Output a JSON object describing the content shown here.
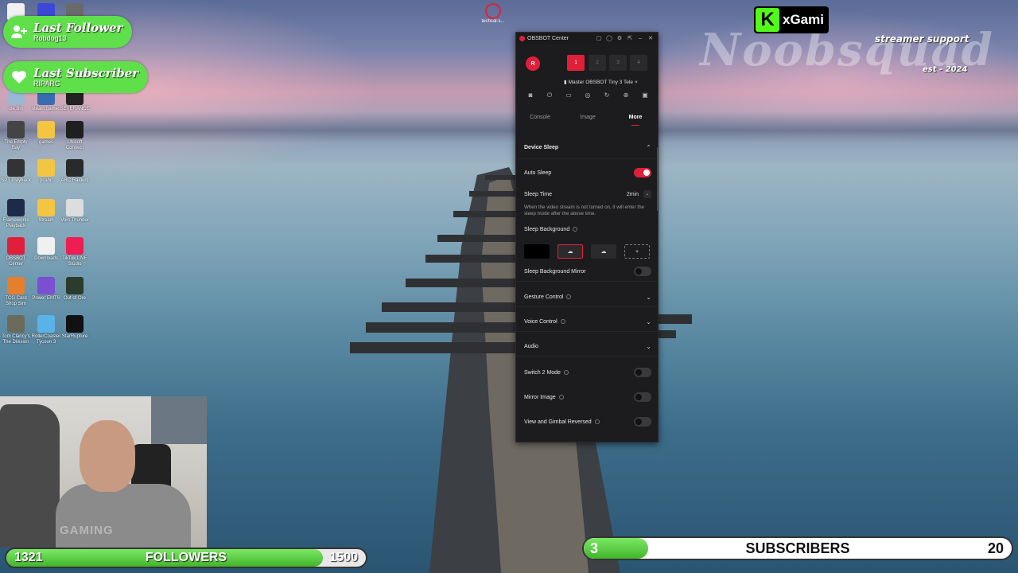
{
  "alerts": {
    "follower_title": "Last Follower",
    "follower_name": "Robdog13",
    "subscriber_title": "Last Subscriber",
    "subscriber_name": "RIPARC"
  },
  "branding": {
    "kick_letter": "K",
    "kick_name": "xGami",
    "big_text": "Noobsquad",
    "tagline": "streamer support",
    "est": "est - 2024"
  },
  "desktop_icons": [
    {
      "label": "",
      "color": "#f0f0f0"
    },
    {
      "label": "",
      "color": "#3c47d8"
    },
    {
      "label": "",
      "color": "#6a6a6a"
    },
    {
      "label": "cle Bin",
      "color": "#9ab7d3"
    },
    {
      "label": "steam games",
      "color": "#3a6db0"
    },
    {
      "label": "SEVERANCE",
      "color": "#222"
    },
    {
      "label": "The Empty Bay",
      "color": "#444"
    },
    {
      "label": "games",
      "color": "#f4c542"
    },
    {
      "label": "Ubisoft Connect",
      "color": "#1f1f1f"
    },
    {
      "label": "SPT Playback",
      "color": "#333"
    },
    {
      "label": "pcahit",
      "color": "#f4c542"
    },
    {
      "label": "ARC Raiders",
      "color": "#2a2a2a"
    },
    {
      "label": "Frameworks Playback",
      "color": "#1d2a4a"
    },
    {
      "label": "Stream",
      "color": "#f4c542"
    },
    {
      "label": "Voin Thunder",
      "color": "#ddd"
    },
    {
      "label": "OBSBOT Center",
      "color": "#e0203a"
    },
    {
      "label": "Downloads",
      "color": "#f0f0f0"
    },
    {
      "label": "TikTok LIVE Studio",
      "color": "#ee1d52"
    },
    {
      "label": "TCG Card Shop Sim",
      "color": "#e57f2b"
    },
    {
      "label": "Power EMTS",
      "color": "#7a4fd0"
    },
    {
      "label": "Out of Ore",
      "color": "#2c3c2c"
    },
    {
      "label": "Tom Clancy's The Division",
      "color": "#6b6b5c"
    },
    {
      "label": "RollerCoaster Tycoon 3",
      "color": "#5ab3e8"
    },
    {
      "label": "StarRupture",
      "color": "#111"
    }
  ],
  "center_icon_label": "techcal-s...",
  "webcam": {
    "shirt_text": "GAMING"
  },
  "followers": {
    "current": "1321",
    "label": "FOLLOWERS",
    "goal": "1500",
    "progress": 0.881
  },
  "subscribers": {
    "current": "3",
    "label": "SUBSCRIBERS",
    "goal": "20",
    "progress": 0.15
  },
  "obsbot": {
    "title": "OBSBOT Center",
    "window_buttons": [
      "▢",
      "◯",
      "⚙",
      "⇱",
      "–",
      "✕"
    ],
    "record_label": "R",
    "slots": [
      "1",
      "2",
      "3",
      "4"
    ],
    "device_name": "Master OBSBOT Tiny 3 Tele",
    "device_close": "×",
    "tabs": [
      "Console",
      "Image",
      "More"
    ],
    "active_tab": "More",
    "device_sleep": {
      "header": "Device Sleep",
      "auto_sleep_label": "Auto Sleep",
      "auto_sleep_on": true,
      "sleep_time_label": "Sleep Time",
      "sleep_time_value": "2min",
      "description": "When the video stream is not turned on, it will enter the sleep mode after the above time.",
      "background_label": "Sleep Background",
      "background_mirror_label": "Sleep Background Mirror",
      "add_symbol": "+"
    },
    "sections": {
      "gesture": "Gesture Control",
      "voice": "Voice Control",
      "audio": "Audio"
    },
    "toggles": {
      "switch2": "Switch 2 Mode",
      "mirror": "Mirror Image",
      "view_gimbal": "View and Gimbal Reversed"
    }
  },
  "colors": {
    "accent": "#e0203a",
    "kick_green": "#53fc18",
    "bar_green": "#41b52b"
  }
}
